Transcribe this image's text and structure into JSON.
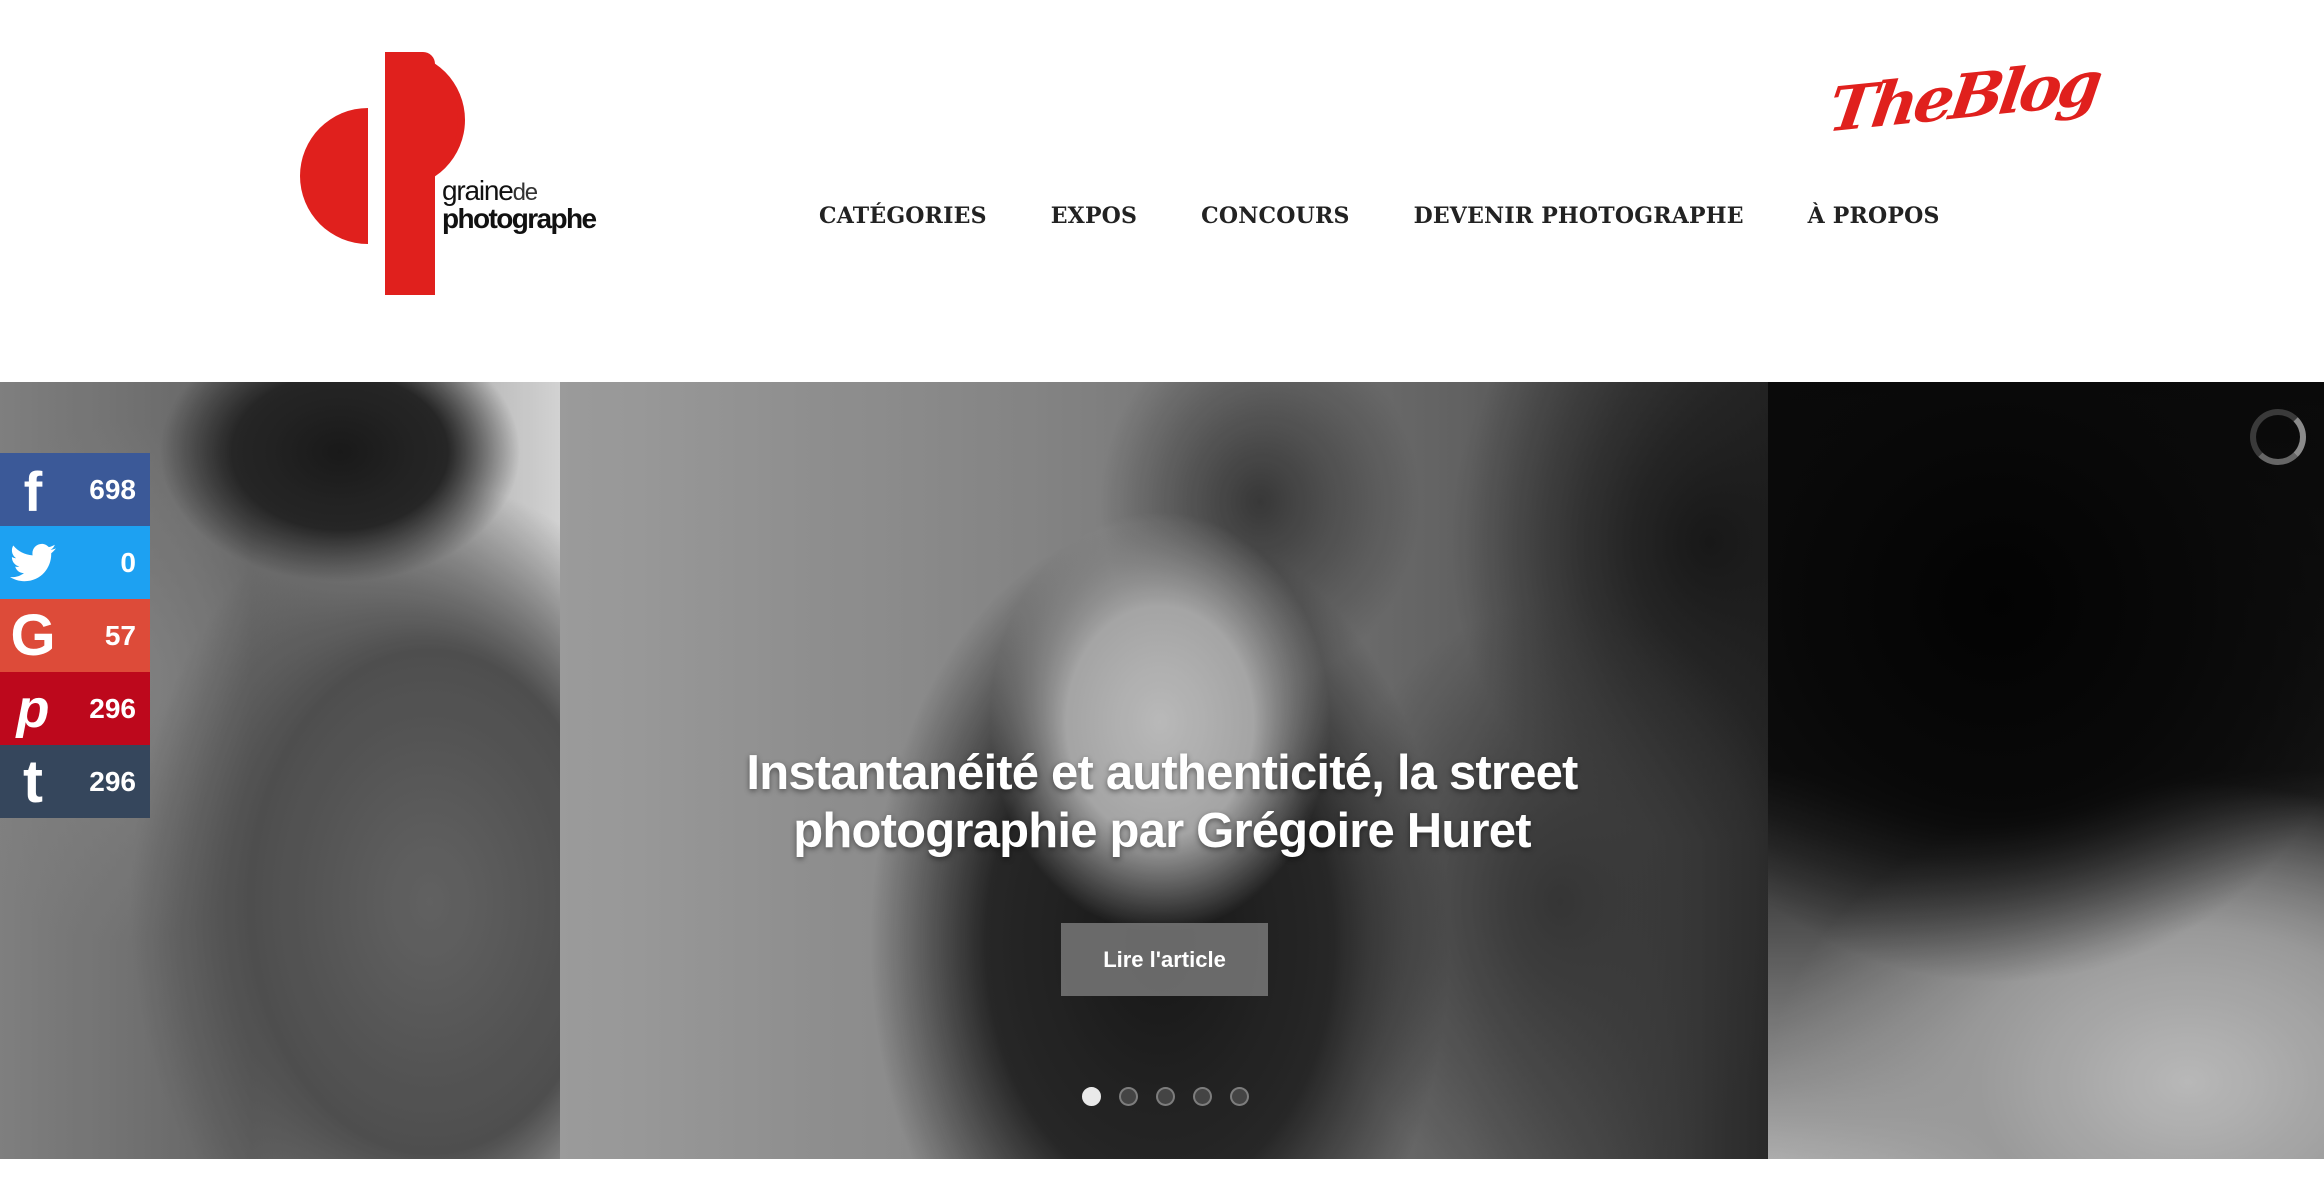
{
  "header": {
    "logo": {
      "line1": "graine",
      "line1_suffix": "de",
      "line2": "photographe",
      "brand_color": "#e0201d"
    },
    "blog_link": "TheBlog",
    "nav": [
      {
        "label": "CATÉGORIES"
      },
      {
        "label": "EXPOS"
      },
      {
        "label": "CONCOURS"
      },
      {
        "label": "DEVENIR PHOTOGRAPHE"
      },
      {
        "label": "À PROPOS"
      }
    ]
  },
  "hero": {
    "title": "Instantanéité et authenticité, la street photographie par Grégoire Huret",
    "button_label": "Lire l'article",
    "slides_count": 5,
    "active_slide": 1
  },
  "social": [
    {
      "network": "facebook",
      "icon": "facebook-icon",
      "count": "698",
      "color": "#3b5998"
    },
    {
      "network": "twitter",
      "icon": "twitter-icon",
      "count": "0",
      "color": "#1da1f2"
    },
    {
      "network": "google",
      "icon": "google-icon",
      "count": "57",
      "color": "#dd4b39"
    },
    {
      "network": "pinterest",
      "icon": "pinterest-icon",
      "count": "296",
      "color": "#bd081c"
    },
    {
      "network": "tumblr",
      "icon": "tumblr-icon",
      "count": "296",
      "color": "#35465c"
    }
  ]
}
